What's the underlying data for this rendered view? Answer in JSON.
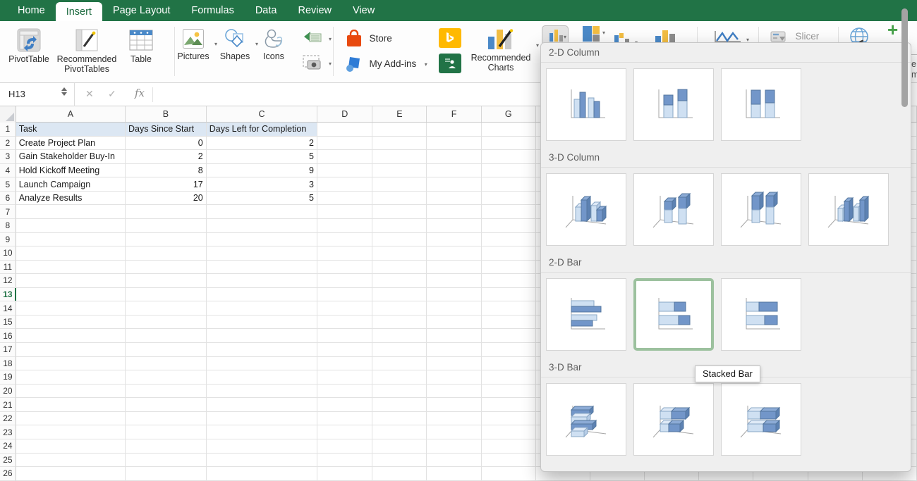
{
  "tab_bar": {
    "tabs": [
      "Home",
      "Insert",
      "Page Layout",
      "Formulas",
      "Data",
      "Review",
      "View"
    ],
    "active_tab": "Insert"
  },
  "ribbon": {
    "pivottable": "PivotTable",
    "recommended_pivottables": "Recommended PivotTables",
    "table": "Table",
    "pictures": "Pictures",
    "shapes": "Shapes",
    "icons": "Icons",
    "store": "Store",
    "my_addins": "My Add-ins",
    "recommended_charts": "Recommended Charts",
    "slicer": "Slicer",
    "icon_names": [
      "pivottable-icon",
      "recommended-pivottables-icon",
      "table-icon",
      "pictures-icon",
      "shapes-icon",
      "duck-icons-icon",
      "smartart-icon",
      "screenshot-camera-icon",
      "store-bag-icon",
      "addins-cube-icon",
      "bing-icon",
      "people-graph-icon",
      "recommended-charts-icon",
      "insert-column-chart-icon",
      "insert-hierarchy-chart-icon",
      "insert-waterfall-chart-icon",
      "insert-statistic-chart-icon",
      "insert-line-chart-icon",
      "slicer-icon",
      "maps-globe-icon",
      "plus-icon"
    ]
  },
  "formula_bar": {
    "name_box": "H13",
    "fx_label": "fx",
    "cancel_glyph": "✕",
    "enter_glyph": "✓"
  },
  "sheet": {
    "visible_columns": [
      "A",
      "B",
      "C",
      "D",
      "E",
      "F",
      "G"
    ],
    "row_count": 26,
    "selected_row": 13,
    "selected_cell": "H13",
    "table": {
      "headers": [
        "Task",
        "Days Since Start",
        "Days Left for Completion"
      ],
      "rows": [
        {
          "task": "Create Project Plan",
          "days_since_start": "0",
          "days_left": "2"
        },
        {
          "task": "Gain Stakeholder Buy-In",
          "days_since_start": "2",
          "days_left": "5"
        },
        {
          "task": "Hold Kickoff Meeting",
          "days_since_start": "8",
          "days_left": "9"
        },
        {
          "task": "Launch Campaign",
          "days_since_start": "17",
          "days_left": "3"
        },
        {
          "task": "Analyze Results",
          "days_since_start": "20",
          "days_left": "5"
        }
      ]
    }
  },
  "chart_menu": {
    "sections": [
      {
        "title": "2-D Column",
        "items": [
          {
            "name": "Clustered Column",
            "icon": "col-clustered",
            "selected": false
          },
          {
            "name": "Stacked Column",
            "icon": "col-stacked",
            "selected": false
          },
          {
            "name": "100% Stacked Column",
            "icon": "col-100",
            "selected": false
          }
        ]
      },
      {
        "title": "3-D Column",
        "items": [
          {
            "name": "3-D Clustered Column",
            "icon": "col3d-clustered",
            "selected": false
          },
          {
            "name": "3-D Stacked Column",
            "icon": "col3d-stacked",
            "selected": false
          },
          {
            "name": "3-D 100% Stacked Column",
            "icon": "col3d-100",
            "selected": false
          },
          {
            "name": "3-D Column",
            "icon": "col3d",
            "selected": false
          }
        ]
      },
      {
        "title": "2-D Bar",
        "items": [
          {
            "name": "Clustered Bar",
            "icon": "bar-clustered",
            "selected": false
          },
          {
            "name": "Stacked Bar",
            "icon": "bar-stacked",
            "selected": true
          },
          {
            "name": "100% Stacked Bar",
            "icon": "bar-100",
            "selected": false
          }
        ]
      },
      {
        "title": "3-D Bar",
        "items": [
          {
            "name": "3-D Clustered Bar",
            "icon": "bar3d-clustered",
            "selected": false
          },
          {
            "name": "3-D Stacked Bar",
            "icon": "bar3d-stacked",
            "selected": false
          },
          {
            "name": "3-D 100% Stacked Bar",
            "icon": "bar3d-100",
            "selected": false
          }
        ]
      }
    ],
    "tooltip": "Stacked Bar"
  },
  "clipped_edge_text": [
    "e",
    "m"
  ],
  "colors": {
    "excel_green": "#217346",
    "selection_frame_green": "#9cc19e",
    "table_header_fill": "#dce7f3",
    "chart_icon_light_blue": "#cfe0f2",
    "chart_icon_dark_blue": "#7296c9"
  }
}
